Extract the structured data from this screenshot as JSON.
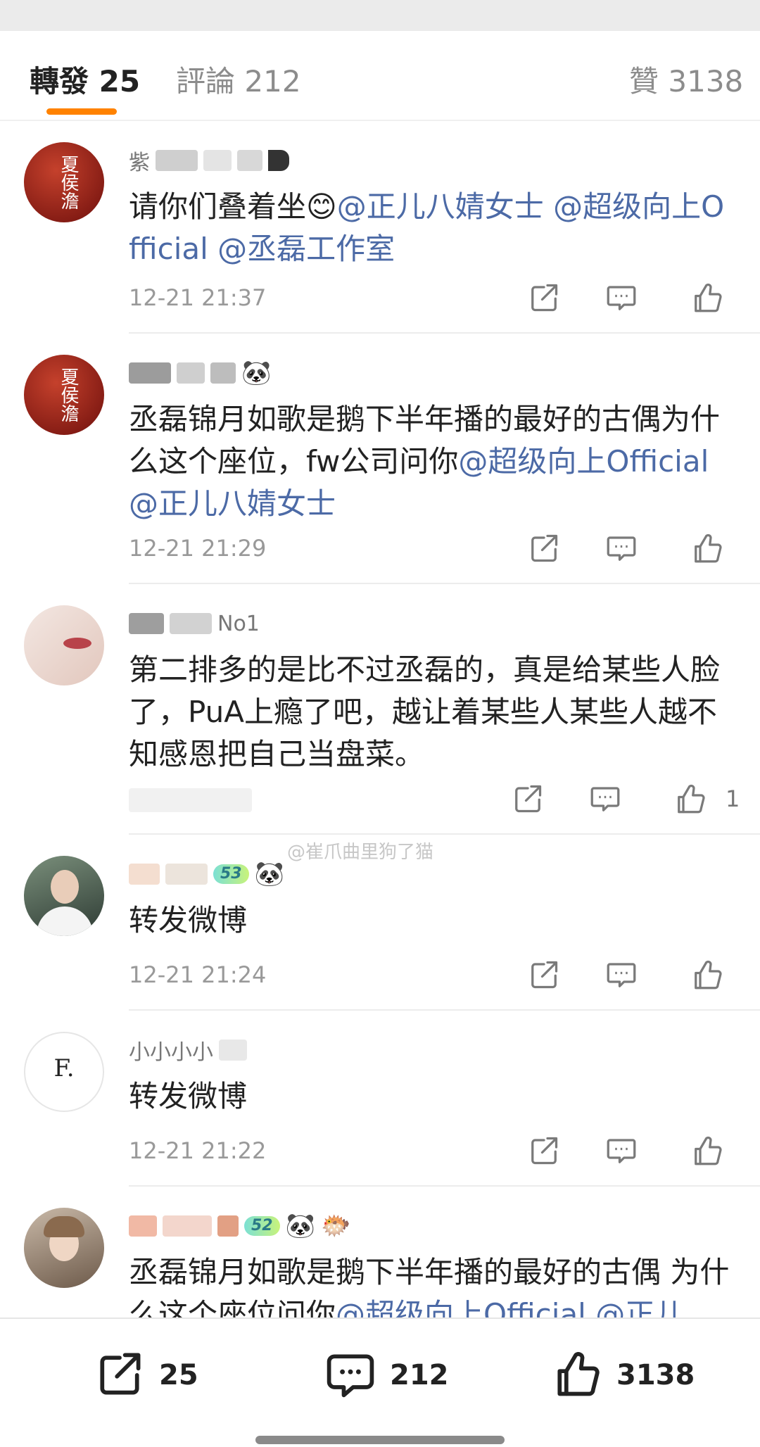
{
  "tabs": {
    "repost": {
      "label": "轉發",
      "count": "25"
    },
    "comments": {
      "label": "評論",
      "count": "212"
    },
    "likes": {
      "label": "贊",
      "count": "3138"
    }
  },
  "comments": [
    {
      "nick_visible": "紫",
      "body_plain": "请你们叠着坐😊",
      "mentions": [
        "@正儿八婧女士",
        "@超级向上Official",
        "@丞磊工作室"
      ],
      "time": "12-21 21:37",
      "likes": ""
    },
    {
      "nick_visible": "",
      "body_plain": "丞磊锦月如歌是鹅下半年播的最好的古偶为什么这个座位，fw公司问你",
      "mentions": [
        "@超级向上Official",
        "@正儿八婧女士"
      ],
      "time": "12-21 21:29",
      "likes": ""
    },
    {
      "nick_visible": "No1",
      "body_plain": "第二排多的是比不过丞磊的，真是给某些人脸了，PuA上瘾了吧，越让着某些人某些人越不知感恩把自己当盘菜。",
      "mentions": [],
      "time": "",
      "likes": "1"
    },
    {
      "nick_visible": "",
      "badge": "53",
      "body_plain": "转发微博",
      "mentions": [],
      "time": "12-21 21:24",
      "likes": ""
    },
    {
      "nick_visible": "小小小小",
      "body_plain": "转发微博",
      "mentions": [],
      "time": "12-21 21:22",
      "likes": ""
    },
    {
      "nick_visible": "",
      "badge": "52",
      "body_plain": "丞磊锦月如歌是鹅下半年播的最好的古偶 为什么这个座位问你",
      "mentions": [
        "@超级向上Official",
        "@正儿"
      ],
      "time": "",
      "likes": ""
    }
  ],
  "avatar_texts": {
    "a1": "夏侯澹",
    "a5": "F."
  },
  "watermark": "@崔爪曲里狗了猫",
  "bottom_bar": {
    "repost": "25",
    "comments": "212",
    "likes": "3138"
  },
  "colors": {
    "accent": "#ff8200",
    "mention": "#4c6aa6",
    "text": "#222222",
    "muted": "#999999"
  },
  "icons": [
    "share-icon",
    "comment-icon",
    "like-icon"
  ]
}
